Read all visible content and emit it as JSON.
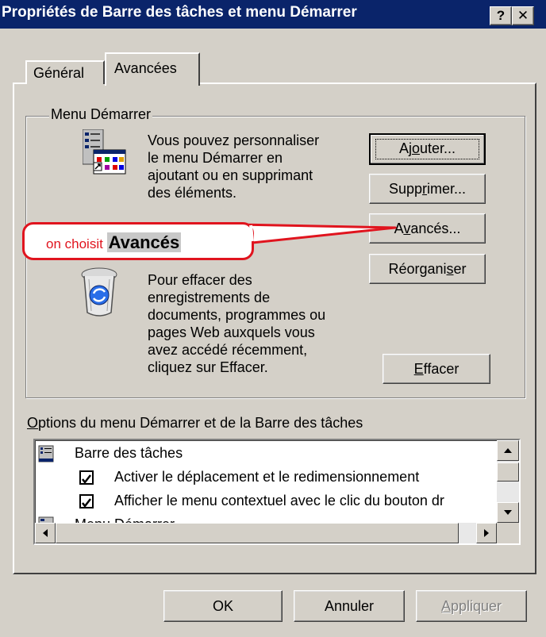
{
  "window": {
    "title": "Propriétés de Barre des tâches et menu Démarrer",
    "help_label": "?",
    "close_label": "✕"
  },
  "tabs": [
    {
      "label": "Général",
      "selected": false
    },
    {
      "label": "Avancées",
      "selected": true
    }
  ],
  "start_menu_group": {
    "label": "Menu Démarrer",
    "customize_text": [
      "Vous pouvez personnaliser",
      "le menu Démarrer en",
      "ajoutant ou en supprimant",
      "des éléments."
    ],
    "clear_text": [
      "Pour effacer des",
      "enregistrements de",
      "documents, programmes ou",
      "pages Web auxquels vous",
      "avez accédé récemment,",
      "cliquez sur Effacer."
    ],
    "buttons": {
      "add": {
        "pre": "Aj",
        "ul": "o",
        "post": "uter..."
      },
      "remove": {
        "pre": "Supp",
        "ul": "r",
        "post": "imer..."
      },
      "advanced": {
        "pre": "A",
        "ul": "v",
        "post": "ancés..."
      },
      "reorganize": {
        "pre": "Réorgani",
        "ul": "s",
        "post": "er"
      },
      "clear": {
        "pre": "",
        "ul": "E",
        "post": "ffacer"
      }
    }
  },
  "options": {
    "label_ul": "O",
    "label_rest": "ptions du menu Démarrer et de la Barre des tâches",
    "items": [
      {
        "label": "Barre des tâches"
      },
      {
        "label": "Activer le déplacement et le redimensionnement",
        "checked": true
      },
      {
        "label": "Afficher le menu contextuel avec le clic du bouton dr",
        "checked": true
      },
      {
        "label": "Menu Démarrer"
      }
    ]
  },
  "dialog_buttons": {
    "ok": "OK",
    "cancel": "Annuler",
    "apply": {
      "ul": "A",
      "rest": "ppliquer",
      "disabled": true
    }
  },
  "annotation": {
    "prefix": "on choisit",
    "highlight": "Avancés",
    "color": "#e0141e"
  },
  "colors": {
    "titlebar": "#0a246a",
    "face": "#d4d0c8",
    "disabled_text": "#808080"
  }
}
